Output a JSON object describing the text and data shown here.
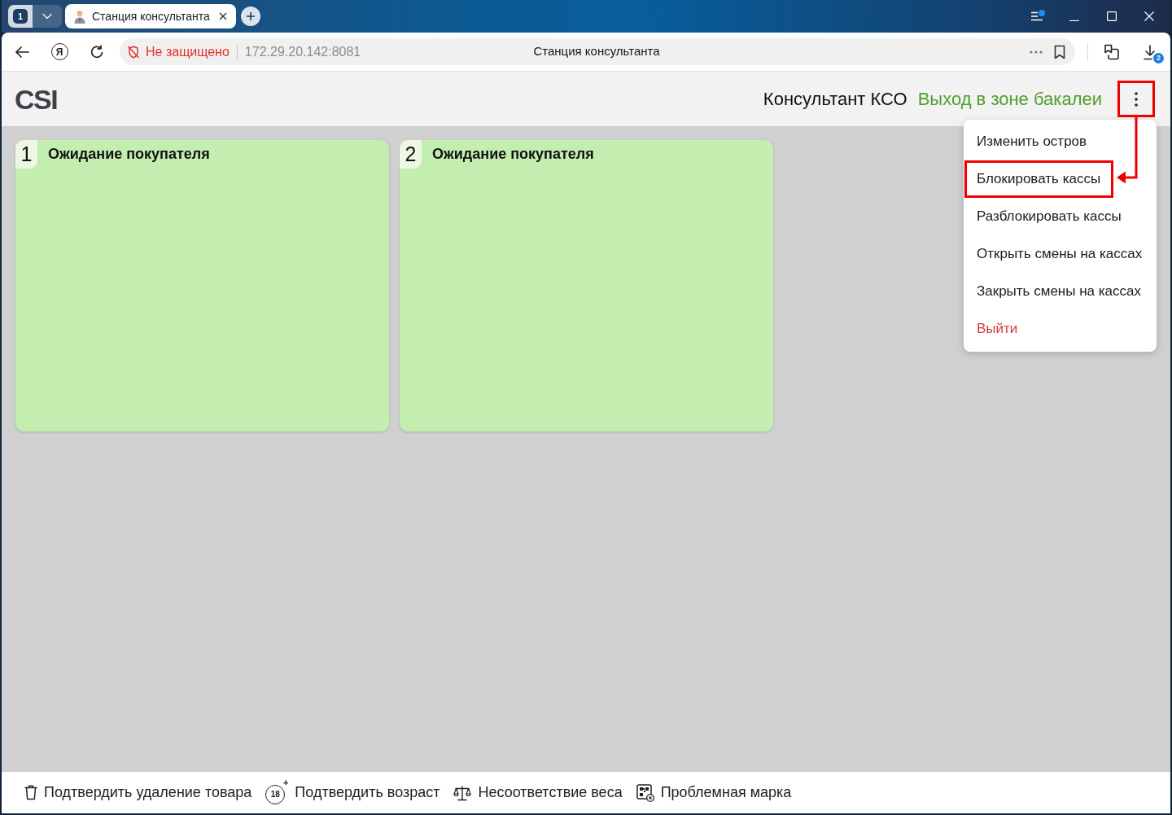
{
  "browser": {
    "tab_group": {
      "count": "1"
    },
    "tabs": [
      {
        "title": "Станция консультанта",
        "selected": true
      }
    ],
    "menu_notification": true,
    "home_letter": "Я",
    "security_warning": "Не защищено",
    "url": "172.29.20.142:8081",
    "page_title": "Станция консультанта",
    "downloads_badge": "2"
  },
  "app": {
    "logo": "CSI",
    "role": "Консультант КСО",
    "zone": "Выход в зоне бакалеи",
    "menu_button": {
      "expanded": true,
      "highlighted": true
    },
    "menu": {
      "items": [
        {
          "label": "Изменить остров",
          "kind": "normal",
          "highlighted": false
        },
        {
          "label": "Блокировать кассы",
          "kind": "normal",
          "highlighted": true
        },
        {
          "label": "Разблокировать кассы",
          "kind": "normal",
          "highlighted": false
        },
        {
          "label": "Открыть смены на кассах",
          "kind": "normal",
          "highlighted": false
        },
        {
          "label": "Закрыть смены на кассах",
          "kind": "normal",
          "highlighted": false
        },
        {
          "label": "Выйти",
          "kind": "danger",
          "highlighted": false
        }
      ]
    },
    "callout_arrow": true
  },
  "stations": [
    {
      "number": "1",
      "status": "Ожидание покупателя",
      "color": "#c4edb0"
    },
    {
      "number": "2",
      "status": "Ожидание покупателя",
      "color": "#c4edb0"
    }
  ],
  "bottom_bar": {
    "actions": [
      {
        "kind": "delete",
        "label": "Подтвердить удаление товара"
      },
      {
        "kind": "age",
        "icon_text": "18$^{+}$",
        "label": "Подтвердить возраст"
      },
      {
        "kind": "weight",
        "label": "Несоответствие веса"
      },
      {
        "kind": "marking",
        "label": "Проблемная марка"
      }
    ]
  }
}
